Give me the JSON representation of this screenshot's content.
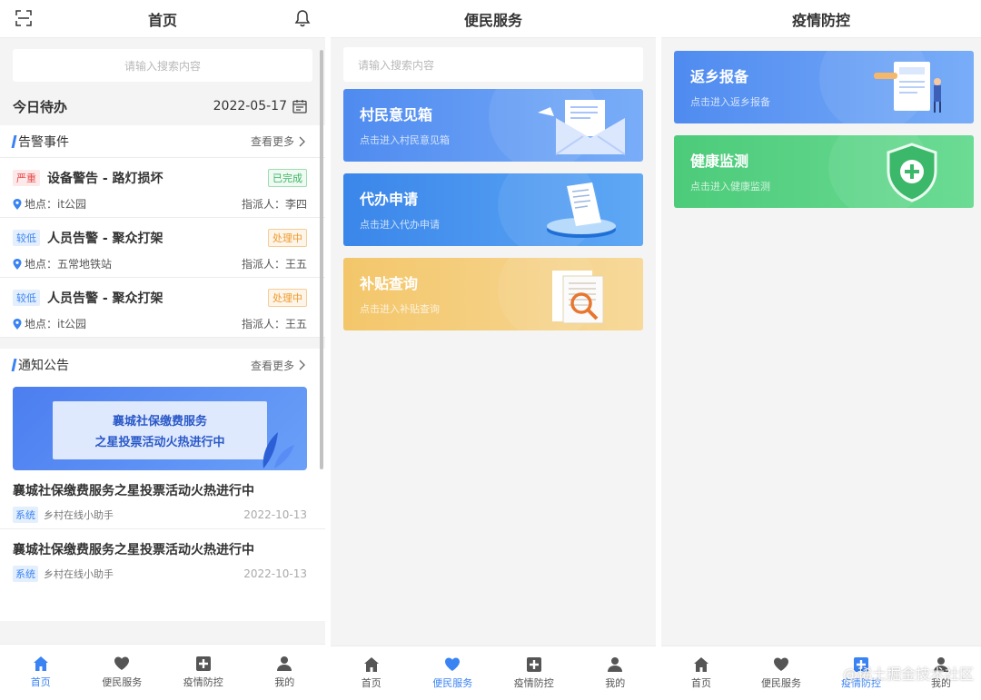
{
  "home": {
    "header_title": "首页",
    "search_placeholder": "请输入搜索内容",
    "todo": {
      "title": "今日待办",
      "date": "2022-05-17"
    },
    "alarms": {
      "title": "告警事件",
      "more": "查看更多",
      "items": [
        {
          "level": "严重",
          "name": "设备警告  -  路灯损坏",
          "status": "已完成",
          "location": "地点：it公园",
          "assignee": "指派人：李四"
        },
        {
          "level": "较低",
          "name": "人员告警  -  聚众打架",
          "status": "处理中",
          "location": "地点：五常地铁站",
          "assignee": "指派人：王五"
        },
        {
          "level": "较低",
          "name": "人员告警  -  聚众打架",
          "status": "处理中",
          "location": "地点：it公园",
          "assignee": "指派人：王五"
        }
      ]
    },
    "notices": {
      "title": "通知公告",
      "more": "查看更多",
      "banner_line1": "襄城社保缴费服务",
      "banner_line2": "之星投票活动火热进行中",
      "items": [
        {
          "title": "襄城社保缴费服务之星投票活动火热进行中",
          "tag": "系统",
          "source": "乡村在线小助手",
          "date": "2022-10-13"
        },
        {
          "title": "襄城社保缴费服务之星投票活动火热进行中",
          "tag": "系统",
          "source": "乡村在线小助手",
          "date": "2022-10-13"
        }
      ]
    }
  },
  "service": {
    "header_title": "便民服务",
    "search_placeholder": "请输入搜索内容",
    "cards": [
      {
        "title": "村民意见箱",
        "subtitle": "点击进入村民意见箱"
      },
      {
        "title": "代办申请",
        "subtitle": "点击进入代办申请"
      },
      {
        "title": "补贴查询",
        "subtitle": "点击进入补贴查询"
      }
    ]
  },
  "epidemic": {
    "header_title": "疫情防控",
    "cards": [
      {
        "title": "返乡报备",
        "subtitle": "点击进入返乡报备"
      },
      {
        "title": "健康监测",
        "subtitle": "点击进入健康监测"
      }
    ]
  },
  "tabbar": {
    "home": "首页",
    "service": "便民服务",
    "epidemic": "疫情防控",
    "mine": "我的"
  },
  "watermark": "@稀土掘金技术社区",
  "colors": {
    "primary": "#3a83f3",
    "severe": "#e84b4b",
    "done": "#3bb565",
    "processing": "#f09a2b"
  }
}
